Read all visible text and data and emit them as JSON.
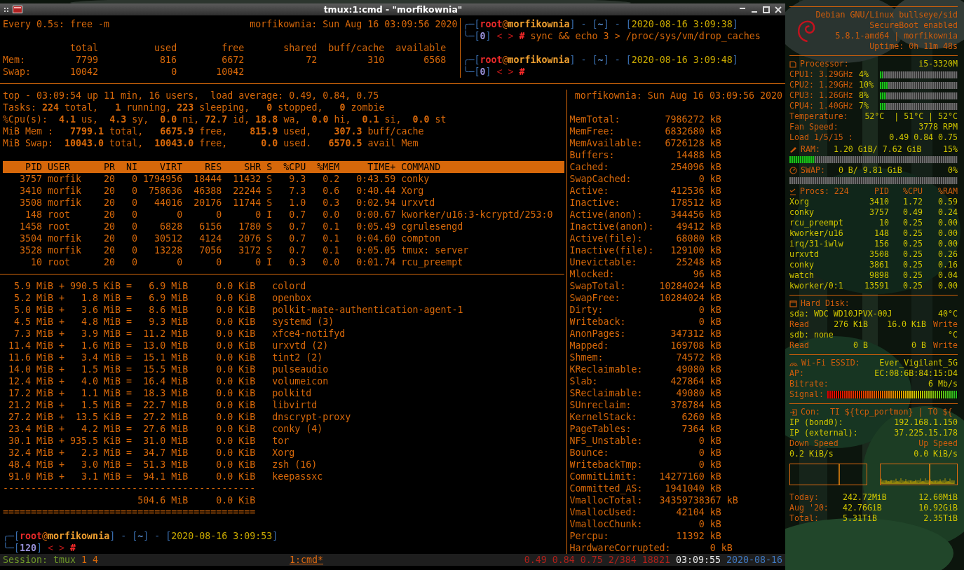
{
  "window": {
    "title": "tmux:1:cmd - \"morfikownia\""
  },
  "free_pane": {
    "command": "Every 0.5s: free -m",
    "clock": "morfikownia: Sun Aug 16 03:09:56 2020",
    "columns": [
      "total",
      "used",
      "free",
      "shared",
      "buff/cache",
      "available"
    ],
    "rows": [
      {
        "label": "Mem:",
        "values": [
          "7799",
          "816",
          "6672",
          "72",
          "310",
          "6568"
        ]
      },
      {
        "label": "Swap:",
        "values": [
          "10042",
          "0",
          "10042"
        ]
      }
    ]
  },
  "shell_pane": {
    "prompts": [
      {
        "lines": [
          [
            {
              "kind": "frame",
              "text": "╭─["
            },
            {
              "kind": "user",
              "text": "root"
            },
            {
              "kind": "at",
              "text": "@"
            },
            {
              "kind": "host",
              "text": "morfikownia"
            },
            {
              "kind": "frame",
              "text": "] - ["
            },
            {
              "kind": "dir",
              "text": "~"
            },
            {
              "kind": "frame",
              "text": "] - ["
            },
            {
              "kind": "time",
              "text": "2020-08-16 3:09:38"
            },
            {
              "kind": "frame",
              "text": "]"
            }
          ],
          [
            {
              "kind": "frame",
              "text": "╰─["
            },
            {
              "kind": "code",
              "text": "0"
            },
            {
              "kind": "frame",
              "text": "]"
            },
            {
              "kind": "arrows",
              "text": " < > "
            },
            {
              "kind": "hash",
              "text": "#"
            },
            {
              "kind": "cmd",
              "text": " sync && echo 3 > /proc/sys/vm/drop_caches"
            }
          ]
        ]
      },
      {
        "lines": [
          [
            {
              "kind": "frame",
              "text": "╭─["
            },
            {
              "kind": "user",
              "text": "root"
            },
            {
              "kind": "at",
              "text": "@"
            },
            {
              "kind": "host",
              "text": "morfikownia"
            },
            {
              "kind": "frame",
              "text": "] - ["
            },
            {
              "kind": "dir",
              "text": "~"
            },
            {
              "kind": "frame",
              "text": "] - ["
            },
            {
              "kind": "time",
              "text": "2020-08-16 3:09:48"
            },
            {
              "kind": "frame",
              "text": "]"
            }
          ],
          [
            {
              "kind": "frame",
              "text": "╰─["
            },
            {
              "kind": "code",
              "text": "0"
            },
            {
              "kind": "frame",
              "text": "]"
            },
            {
              "kind": "arrows",
              "text": " < > "
            },
            {
              "kind": "hash",
              "text": "#"
            }
          ]
        ]
      }
    ]
  },
  "top_pane": {
    "summary": [
      "top - 03:09:54 up 11 min, 16 users,  load average: 0.49, 0.84, 0.75",
      "Tasks: **224** total,   **1** running, **223** sleeping,   **0** stopped,   **0** zombie",
      "%Cpu(s):  **4.1** us,  **4.3** sy,  **0.0** ni, **72.7** id, **18.8** wa,  **0.0** hi,  **0.1** si,  **0.0** st",
      "MiB Mem :   **7799.1** total,   **6675.9** free,    **815.9** used,    **307.3** buff/cache",
      "MiB Swap:  **10043.0** total,  **10043.0** free,      **0.0** used.   **6570.5** avail Mem"
    ],
    "columns": [
      "PID",
      "USER",
      "PR",
      "NI",
      "VIRT",
      "RES",
      "SHR",
      "S",
      "%CPU",
      "%MEM",
      "TIME+",
      "COMMAND"
    ],
    "rows": [
      [
        "3757",
        "morfik",
        "20",
        "0",
        "1794956",
        "18444",
        "11432",
        "S",
        "9.3",
        "0.2",
        "0:43.59",
        "conky"
      ],
      [
        "3410",
        "morfik",
        "20",
        "0",
        "758636",
        "46388",
        "22244",
        "S",
        "7.3",
        "0.6",
        "0:40.44",
        "Xorg"
      ],
      [
        "3508",
        "morfik",
        "20",
        "0",
        "44016",
        "20176",
        "11744",
        "S",
        "1.0",
        "0.3",
        "0:02.94",
        "urxvtd"
      ],
      [
        "148",
        "root",
        "20",
        "0",
        "0",
        "0",
        "0",
        "I",
        "0.7",
        "0.0",
        "0:00.67",
        "kworker/u16:3-kcryptd/253:0"
      ],
      [
        "1458",
        "root",
        "20",
        "0",
        "6828",
        "6156",
        "1780",
        "S",
        "0.7",
        "0.1",
        "0:05.49",
        "cgrulesengd"
      ],
      [
        "3504",
        "morfik",
        "20",
        "0",
        "30512",
        "4124",
        "2076",
        "S",
        "0.7",
        "0.1",
        "0:04.60",
        "compton"
      ],
      [
        "3528",
        "morfik",
        "20",
        "0",
        "13228",
        "7056",
        "3172",
        "S",
        "0.7",
        "0.1",
        "0:05.05",
        "tmux: server"
      ],
      [
        "10",
        "root",
        "20",
        "0",
        "0",
        "0",
        "0",
        "I",
        "0.3",
        "0.0",
        "0:01.74",
        "rcu_preempt"
      ]
    ]
  },
  "ps_mem_pane": {
    "lines": [
      "  5.9 MiB + 990.5 KiB =   6.9 MiB     0.0 KiB   colord",
      "  5.2 MiB +   1.8 MiB =   6.9 MiB     0.0 KiB   openbox",
      "  5.0 MiB +   3.6 MiB =   8.6 MiB     0.0 KiB   polkit-mate-authentication-agent-1",
      "  4.5 MiB +   4.8 MiB =   9.3 MiB     0.0 KiB   systemd (3)",
      "  7.3 MiB +   3.9 MiB =  11.2 MiB     0.0 KiB   xfce4-notifyd",
      " 11.4 MiB +   1.6 MiB =  13.0 MiB     0.0 KiB   urxvtd (2)",
      " 11.6 MiB +   3.4 MiB =  15.1 MiB     0.0 KiB   tint2 (2)",
      " 14.0 MiB +   1.5 MiB =  15.5 MiB     0.0 KiB   pulseaudio",
      " 12.4 MiB +   4.0 MiB =  16.4 MiB     0.0 KiB   volumeicon",
      " 17.2 MiB +   1.1 MiB =  18.3 MiB     0.0 KiB   polkitd",
      " 21.2 MiB +   1.5 MiB =  22.7 MiB     0.0 KiB   libvirtd",
      " 27.2 MiB +  13.5 KiB =  27.2 MiB     0.0 KiB   dnscrypt-proxy",
      " 23.4 MiB +   4.2 MiB =  27.6 MiB     0.0 KiB   conky (4)",
      " 30.1 MiB + 935.5 KiB =  31.0 MiB     0.0 KiB   tor",
      " 32.4 MiB +   2.3 MiB =  34.7 MiB     0.0 KiB   Xorg",
      " 48.4 MiB +   3.0 MiB =  51.3 MiB     0.0 KiB   zsh (16)",
      " 91.0 MiB +   3.1 MiB =  94.1 MiB     0.0 KiB   keepassxc"
    ],
    "rule": "---------------------------------------------",
    "total": "504.6 MiB     0.0 KiB",
    "double_rule": "=============================================",
    "prompt": {
      "lines": [
        [
          {
            "kind": "frame",
            "text": "╭─["
          },
          {
            "kind": "user",
            "text": "root"
          },
          {
            "kind": "at",
            "text": "@"
          },
          {
            "kind": "host",
            "text": "morfikownia"
          },
          {
            "kind": "frame",
            "text": "] - ["
          },
          {
            "kind": "dir",
            "text": "~"
          },
          {
            "kind": "frame",
            "text": "] - ["
          },
          {
            "kind": "time",
            "text": "2020-08-16 3:09:53"
          },
          {
            "kind": "frame",
            "text": "]"
          }
        ],
        [
          {
            "kind": "frame",
            "text": "╰─["
          },
          {
            "kind": "code",
            "text": "120"
          },
          {
            "kind": "frame",
            "text": "]"
          },
          {
            "kind": "arrows",
            "text": " < > "
          },
          {
            "kind": "hash",
            "text": "#"
          }
        ]
      ]
    }
  },
  "meminfo_pane": {
    "clock": "morfikownia: Sun Aug 16 03:09:56 2020",
    "rows": [
      {
        "label": "MemTotal:",
        "value": "7986272 kB"
      },
      {
        "label": "MemFree:",
        "value": "6832680 kB"
      },
      {
        "label": "MemAvailable:",
        "value": "6726128 kB"
      },
      {
        "label": "Buffers:",
        "value": "14488 kB"
      },
      {
        "label": "Cached:",
        "value": "254096 kB"
      },
      {
        "label": "SwapCached:",
        "value": "0 kB"
      },
      {
        "label": "Active:",
        "value": "412536 kB"
      },
      {
        "label": "Inactive:",
        "value": "178512 kB"
      },
      {
        "label": "Active(anon):",
        "value": "344456 kB"
      },
      {
        "label": "Inactive(anon):",
        "value": "49412 kB"
      },
      {
        "label": "Active(file):",
        "value": "68080 kB"
      },
      {
        "label": "Inactive(file):",
        "value": "129100 kB"
      },
      {
        "label": "Unevictable:",
        "value": "25248 kB"
      },
      {
        "label": "Mlocked:",
        "value": "96 kB"
      },
      {
        "label": "SwapTotal:",
        "value": "10284024 kB"
      },
      {
        "label": "SwapFree:",
        "value": "10284024 kB"
      },
      {
        "label": "Dirty:",
        "value": "0 kB"
      },
      {
        "label": "Writeback:",
        "value": "0 kB"
      },
      {
        "label": "AnonPages:",
        "value": "347312 kB"
      },
      {
        "label": "Mapped:",
        "value": "169708 kB"
      },
      {
        "label": "Shmem:",
        "value": "74572 kB"
      },
      {
        "label": "KReclaimable:",
        "value": "49080 kB"
      },
      {
        "label": "Slab:",
        "value": "427864 kB"
      },
      {
        "label": "SReclaimable:",
        "value": "49080 kB"
      },
      {
        "label": "SUnreclaim:",
        "value": "378784 kB"
      },
      {
        "label": "KernelStack:",
        "value": "6260 kB"
      },
      {
        "label": "PageTables:",
        "value": "7364 kB"
      },
      {
        "label": "NFS_Unstable:",
        "value": "0 kB"
      },
      {
        "label": "Bounce:",
        "value": "0 kB"
      },
      {
        "label": "WritebackTmp:",
        "value": "0 kB"
      },
      {
        "label": "CommitLimit:",
        "value": "14277160 kB"
      },
      {
        "label": "Committed_AS:",
        "value": "1941040 kB"
      },
      {
        "label": "VmallocTotal:",
        "value": "34359738367 kB"
      },
      {
        "label": "VmallocUsed:",
        "value": "42104 kB"
      },
      {
        "label": "VmallocChunk:",
        "value": "0 kB"
      },
      {
        "label": "Percpu:",
        "value": "11392 kB"
      },
      {
        "label": "HardwareCorrupted:",
        "value": "0 kB"
      }
    ]
  },
  "status_bar": {
    "left": [
      {
        "kind": "label",
        "text": "Session:"
      },
      {
        "kind": "session",
        "text": "tmux"
      },
      {
        "kind": "count",
        "text": "1 4"
      }
    ],
    "windows": [
      {
        "label": "1:cmd*",
        "selected": true
      }
    ],
    "right": [
      {
        "kind": "load",
        "text": "0.49 0.84 0.75 2/384 18821"
      },
      {
        "kind": "time",
        "text": "03:09:55"
      },
      {
        "kind": "date",
        "text": "2020-08-16"
      }
    ]
  },
  "conky": {
    "system": [
      "Debian GNU/Linux bullseye/sid",
      "SecureBoot enabled",
      "5.8.1-amd64 | morfikownia",
      "Uptime: 0h 11m 48s"
    ],
    "processor": {
      "label": "Processor:",
      "model": "i5-3320M",
      "cores": [
        {
          "label": "CPU1: 3.29GHz",
          "usage": "4%",
          "level": 0.04
        },
        {
          "label": "CPU2: 1.29GHz",
          "usage": "10%",
          "level": 0.1
        },
        {
          "label": "CPU3: 1.26GHz",
          "usage": "8%",
          "level": 0.08
        },
        {
          "label": "CPU4: 1.40GHz",
          "usage": "7%",
          "level": 0.07
        }
      ]
    },
    "sensors": [
      {
        "label": "Temperature:",
        "value": "52°C  | 51°C | 52°C"
      },
      {
        "label": "Fan Speed:",
        "value": "3778 RPM"
      },
      {
        "label": "Load 1/5/15 :",
        "value": "0.49 0.84 0.75"
      }
    ],
    "memory": [
      {
        "kind": "ram",
        "label": "RAM:",
        "value": "1.20 GiB/ 7.62 GiB",
        "percent": "15%",
        "level": 0.15
      },
      {
        "kind": "swap",
        "label": "SWAP:",
        "value": "0 B/ 9.81 GiB",
        "percent": "0%",
        "level": 0
      }
    ],
    "processes": {
      "columns": [
        "Procs: 224",
        "PID",
        "%CPU",
        "%RAM"
      ],
      "rows": [
        [
          "Xorg",
          "3410",
          "1.72",
          "0.59"
        ],
        [
          "conky",
          "3757",
          "0.49",
          "0.24"
        ],
        [
          "rcu_preempt",
          "10",
          "0.25",
          "0.00"
        ],
        [
          "kworker/u16",
          "148",
          "0.25",
          "0.00"
        ],
        [
          "irq/31-iwlw",
          "156",
          "0.25",
          "0.00"
        ],
        [
          "urxvtd",
          "3508",
          "0.25",
          "0.26"
        ],
        [
          "conky",
          "3861",
          "0.25",
          "0.16"
        ],
        [
          "watch",
          "9898",
          "0.25",
          "0.04"
        ],
        [
          "kworker/0:1",
          "13591",
          "0.25",
          "0.00"
        ]
      ]
    },
    "disk": {
      "title": "Hard Disk:",
      "rows": [
        {
          "kind": "device",
          "name": "sda: WDC WD10JPVX-00J",
          "temp": "40°C"
        },
        {
          "kind": "io",
          "read_label": "Read",
          "read": "276 KiB",
          "write": "16.0 KiB",
          "write_label": "Write"
        },
        {
          "kind": "device",
          "name": "sdb: none",
          "temp": "°C"
        },
        {
          "kind": "io",
          "read_label": "Read",
          "read": "0 B",
          "write": "0 B",
          "write_label": "Write"
        }
      ]
    },
    "wifi": {
      "title": "Wi-Fi ESSID:",
      "essid": "Ever_Vigilant_5G",
      "rows": [
        {
          "label": "AP:",
          "value": "EC:08:6B:84:15:D4"
        },
        {
          "label": "Bitrate:",
          "value": "6 Mb/s"
        }
      ],
      "signal": {
        "label": "Signal:",
        "level": 1
      }
    },
    "network": {
      "title": "Con:  TI ${tcp_portmon} | TO ${",
      "addresses": [
        {
          "label": "IP (bond0):",
          "value": "192.168.1.150"
        },
        {
          "label": "IP (external):",
          "value": "37.225.15.178"
        }
      ],
      "speed_labels": [
        "Down Speed",
        "Up Speed"
      ],
      "speeds": [
        "0.2 KiB/s",
        "0.0 KiB/s"
      ],
      "traffic": [
        {
          "label": "Today:",
          "down": "242.72MiB",
          "up": "12.60MiB"
        },
        {
          "label": "Aug '20:",
          "down": "42.76GiB",
          "up": "10.92GiB"
        },
        {
          "label": "Total:",
          "down": "5.31TiB",
          "up": "2.35TiB"
        }
      ]
    }
  }
}
